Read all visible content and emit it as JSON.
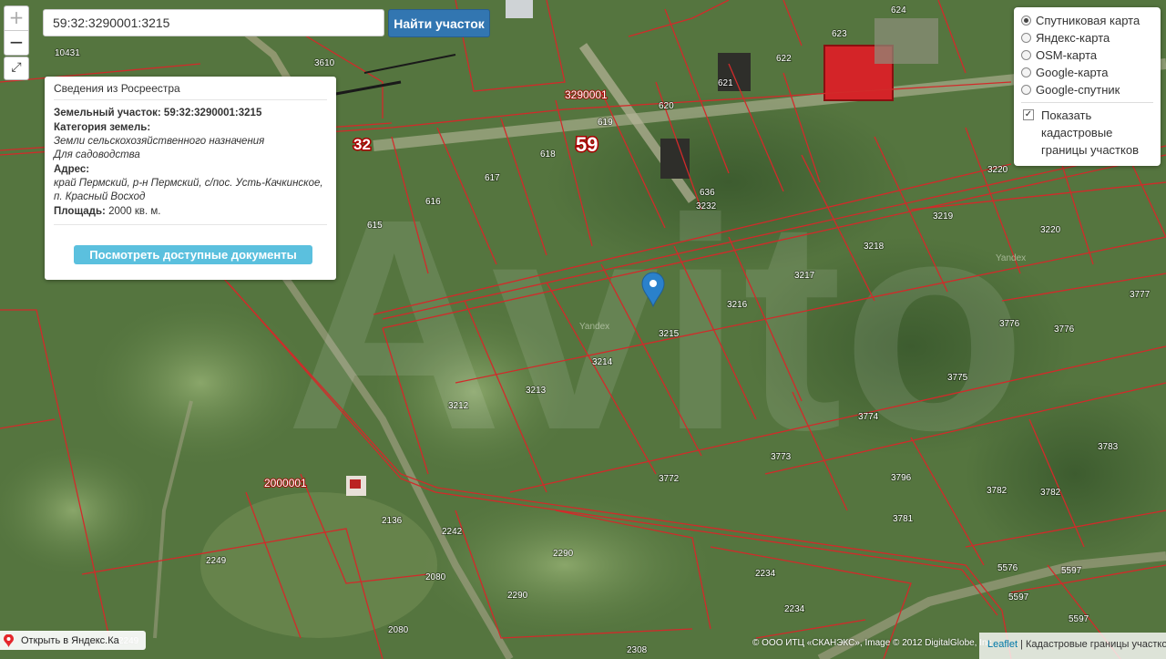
{
  "search": {
    "value": "59:32:3290001:3215",
    "button": "Найти участок"
  },
  "zoom": {
    "in": "+",
    "out": "−",
    "fullscreen": "⤢"
  },
  "layers": {
    "options": [
      {
        "label": "Спутниковая карта",
        "selected": true
      },
      {
        "label": "Яндекс-карта",
        "selected": false
      },
      {
        "label": "OSM-карта",
        "selected": false
      },
      {
        "label": "Google-карта",
        "selected": false
      },
      {
        "label": "Google-спутник",
        "selected": false
      }
    ],
    "checkbox": {
      "label_1": "Показать",
      "label_2": "кадастровые",
      "label_3": "границы участков",
      "checked": true
    }
  },
  "info": {
    "title": "Сведения из Росреестра",
    "parcel_label": "Земельный участок:",
    "parcel_value": "59:32:3290001:3215",
    "category_label": "Категория земель:",
    "category_1": "Земли сельскохозяйственного назначения",
    "category_2": "Для садоводства",
    "address_label": "Адрес:",
    "address_1": "край Пермский, р-н Пермский, с/пос. Усть-Качкинское,",
    "address_2": "п. Красный Восход",
    "area_label": "Площадь:",
    "area_value": "2000 кв. м.",
    "docs_button": "Посмотреть доступные документы"
  },
  "map": {
    "region_number": "59",
    "district_number": "32",
    "block_label": "3290001",
    "block_label_2": "2000001",
    "parcel_labels": [
      "10431",
      "3610",
      "624",
      "623",
      "622",
      "621",
      "620",
      "619",
      "618",
      "617",
      "616",
      "615",
      "3220",
      "3219",
      "3220",
      "3218",
      "3217",
      "3216",
      "3215",
      "3214",
      "3213",
      "3212",
      "3777",
      "3776",
      "3776",
      "3775",
      "3774",
      "3773",
      "3772",
      "3783",
      "3782",
      "3782",
      "3781",
      "3796",
      "2136",
      "2249",
      "2249",
      "2290",
      "2290",
      "2242",
      "2080",
      "2080",
      "2234",
      "2234",
      "5576",
      "5597",
      "5597",
      "5597",
      "2308",
      "3232",
      "636",
      "2249"
    ],
    "watermark": "Yandex",
    "background_text": "Avito"
  },
  "footer": {
    "open_yandex": "Открыть в Яндекс.Ка",
    "copyright": "© ООО ИТЦ «СКАНЭКС», Image © 2012 DigitalGlobe, Inc",
    "leaflet": "Leaflet",
    "attrib_sep": " | ",
    "attrib_text": "Кадастровые границы участков"
  },
  "colors": {
    "accent": "#3276b1",
    "info_button": "#5bc0de",
    "cadastral_line": "#c8242b",
    "pin": "#2a81cb"
  }
}
